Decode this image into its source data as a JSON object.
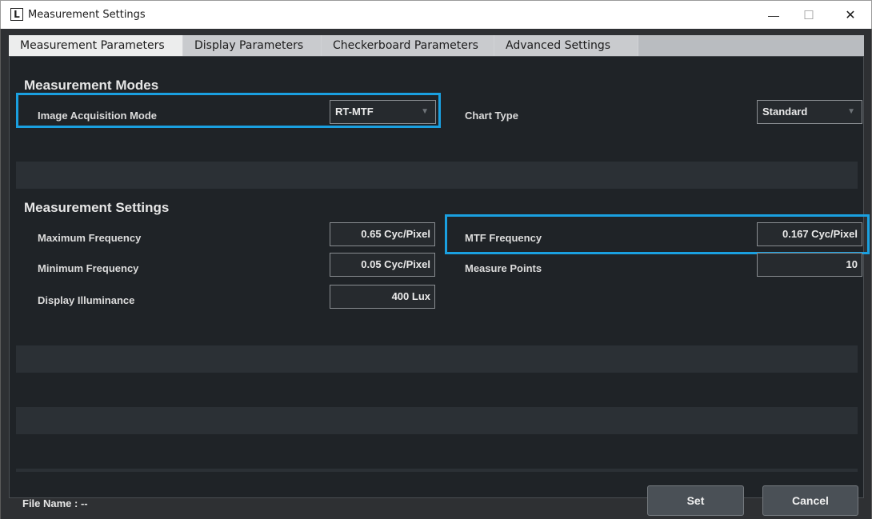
{
  "window": {
    "title": "Measurement Settings",
    "logo_letter": "L",
    "min_icon": "—",
    "max_icon": "☐",
    "close_icon": "✕"
  },
  "tabs": [
    {
      "label": "Measurement Parameters",
      "active": true
    },
    {
      "label": "Display Parameters",
      "active": false
    },
    {
      "label": "Checkerboard Parameters",
      "active": false
    },
    {
      "label": "Advanced Settings",
      "active": false
    }
  ],
  "modes": {
    "title": "Measurement Modes",
    "acquisition_label": "Image Acquisition Mode",
    "acquisition_value": "RT-MTF",
    "chart_type_label": "Chart Type",
    "chart_type_value": "Standard"
  },
  "settings": {
    "title": "Measurement Settings",
    "max_freq_label": "Maximum Frequency",
    "max_freq_value": "0.65 Cyc/Pixel",
    "min_freq_label": "Minimum Frequency",
    "min_freq_value": "0.05 Cyc/Pixel",
    "illuminance_label": "Display Illuminance",
    "illuminance_value": "400 Lux",
    "mtf_freq_label": "MTF Frequency",
    "mtf_freq_value": "0.167 Cyc/Pixel",
    "measure_points_label": "Measure Points",
    "measure_points_value": "10"
  },
  "footer": {
    "file_name_label": "File Name :  --",
    "set_label": "Set",
    "cancel_label": "Cancel"
  },
  "colors": {
    "highlight": "#1aa0e0",
    "background": "#1f2327",
    "row_alt": "#2b3035"
  }
}
